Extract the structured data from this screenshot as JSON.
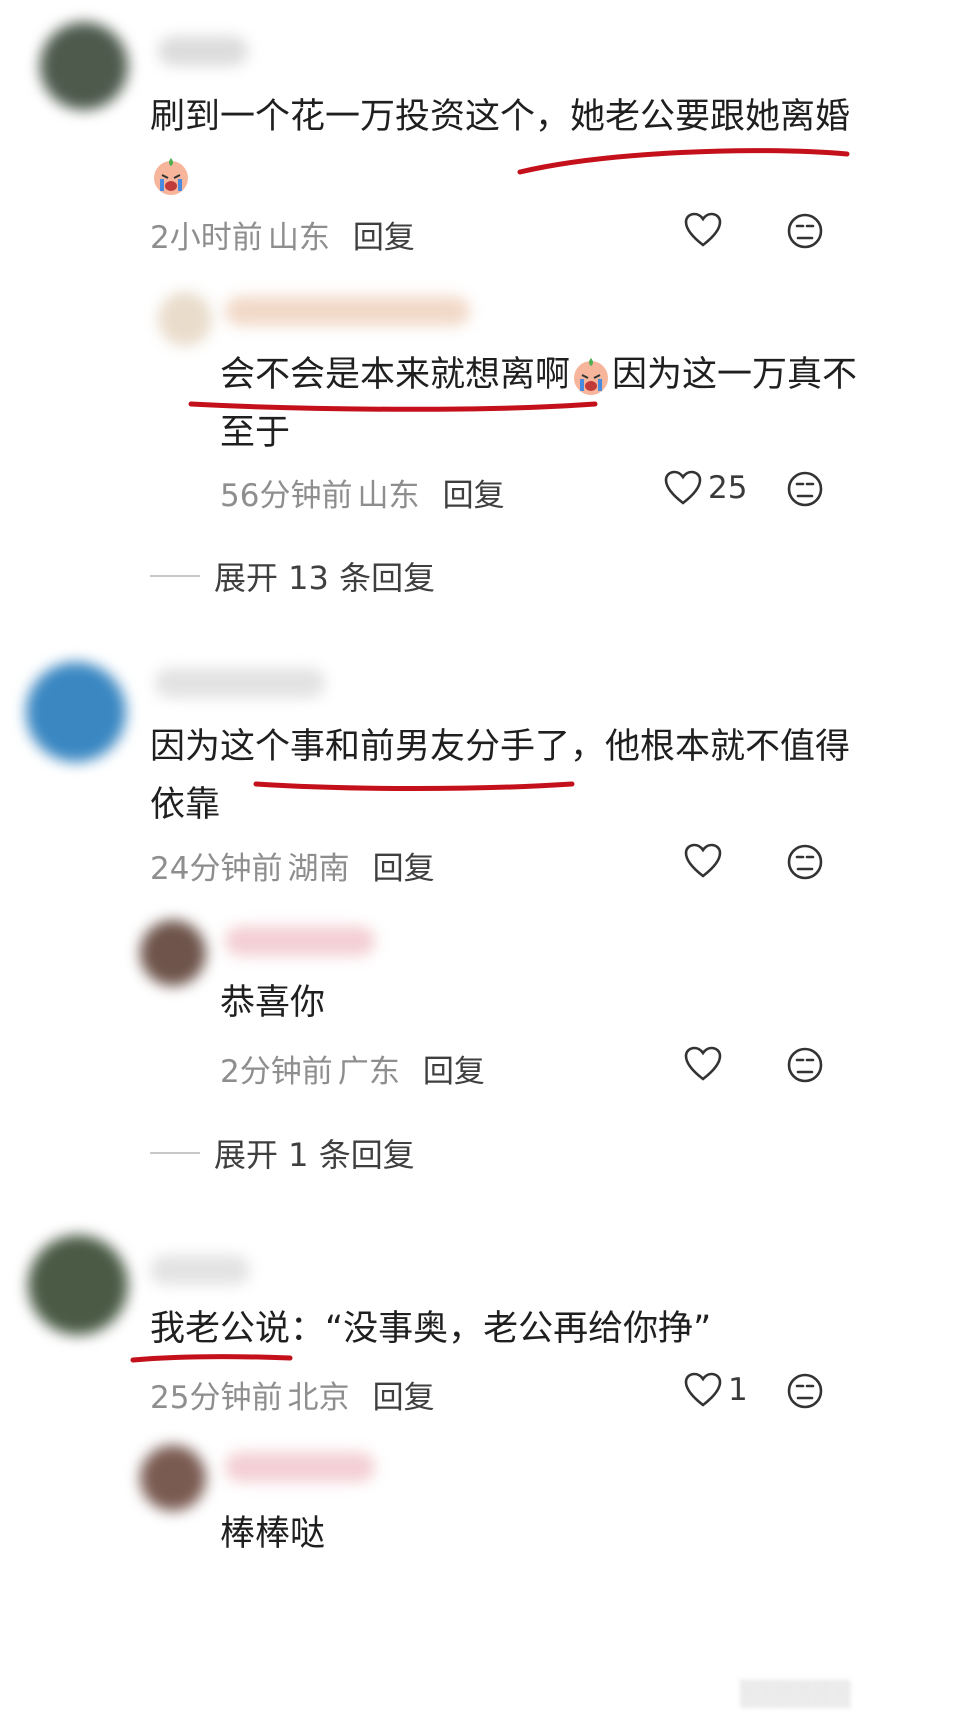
{
  "comments": [
    {
      "text": "刷到一个花一万投资这个，她老公要跟她离婚",
      "time": "2小时前",
      "location": "山东",
      "reply_label": "回复",
      "likes": "",
      "avatar_color": "#4d5a4c",
      "reply": {
        "text_a": "会不会是本来就想离啊",
        "text_b": "因为这一万真不",
        "text_c": "至于",
        "time": "56分钟前",
        "location": "山东",
        "reply_label": "回复",
        "likes": "25",
        "avatar_color": "#e9dccb"
      },
      "expand_label": "展开 13 条回复"
    },
    {
      "text_a": "因为这个事和前男友分手了，他根本就不值得",
      "text_b": "依靠",
      "time": "24分钟前",
      "location": "湖南",
      "reply_label": "回复",
      "likes": "",
      "avatar_color": "#3a87c2",
      "reply": {
        "text": "恭喜你",
        "time": "2分钟前",
        "location": "广东",
        "reply_label": "回复",
        "likes": "",
        "avatar_color": "#6e544b"
      },
      "expand_label": "展开 1 条回复"
    },
    {
      "text": "我老公说：“没事奥，老公再给你挣”",
      "time": "25分钟前",
      "location": "北京",
      "reply_label": "回复",
      "likes": "1",
      "avatar_color": "#4a5a45",
      "reply": {
        "text": "棒棒哒",
        "avatar_color": "#7a5b52"
      }
    }
  ],
  "colors": {
    "annotation_red": "#c4101a",
    "meta_gray": "#8e8e8e"
  },
  "icons": [
    "heart-icon",
    "meh-face-icon",
    "crying-emoji-icon"
  ]
}
